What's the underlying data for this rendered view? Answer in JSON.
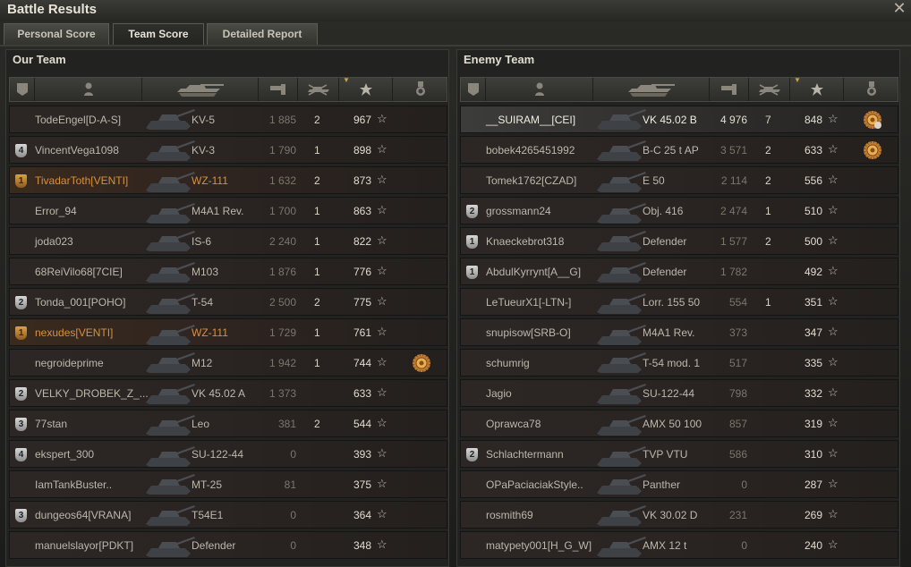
{
  "window": {
    "title": "Battle Results",
    "close_icon": "close-icon"
  },
  "tabs": [
    {
      "label": "Personal Score",
      "active": false
    },
    {
      "label": "Team Score",
      "active": true
    },
    {
      "label": "Detailed Report",
      "active": false
    }
  ],
  "header_icons": [
    "rank-icon",
    "player-icon",
    "tank-icon",
    "xp-icon",
    "kills-icon",
    "score-star-icon",
    "medal-icon"
  ],
  "our_team": {
    "title": "Our Team",
    "rows": [
      {
        "name": "TodeEngel[D-A-S]",
        "tank": "KV-5",
        "xp": "1 885",
        "kills": "2",
        "score": "967",
        "rank": "",
        "style": ""
      },
      {
        "name": "VincentVega1098",
        "tank": "KV-3",
        "xp": "1 790",
        "kills": "1",
        "score": "898",
        "rank": "4",
        "style": ""
      },
      {
        "name": "TivadarToth[VENTI]",
        "tank": "WZ-111",
        "xp": "1 632",
        "kills": "2",
        "score": "873",
        "rank": "1",
        "rank_style": "gold",
        "style": "orange"
      },
      {
        "name": "Error_94",
        "tank": "M4A1 Rev.",
        "xp": "1 700",
        "kills": "1",
        "score": "863",
        "rank": "",
        "style": ""
      },
      {
        "name": "joda023",
        "tank": "IS-6",
        "xp": "2 240",
        "kills": "1",
        "score": "822",
        "rank": "",
        "style": ""
      },
      {
        "name": "68ReiVilo68[7CIE]",
        "tank": "M103",
        "xp": "1 876",
        "kills": "1",
        "score": "776",
        "rank": "",
        "style": ""
      },
      {
        "name": "Tonda_001[POHO]",
        "tank": "T-54",
        "xp": "2 500",
        "kills": "2",
        "score": "775",
        "rank": "2",
        "style": ""
      },
      {
        "name": "nexudes[VENTI]",
        "tank": "WZ-111",
        "xp": "1 729",
        "kills": "1",
        "score": "761",
        "rank": "1",
        "rank_style": "gold",
        "style": "orange"
      },
      {
        "name": "negroideprime",
        "tank": "M12",
        "xp": "1 942",
        "kills": "1",
        "score": "744",
        "rank": "",
        "style": "",
        "medal": true
      },
      {
        "name": "VELKY_DROBEK_Z_...",
        "tank": "VK 45.02 A",
        "xp": "1 373",
        "kills": "",
        "score": "633",
        "rank": "2",
        "style": ""
      },
      {
        "name": "77stan",
        "tank": "Leo",
        "xp": "381",
        "kills": "2",
        "score": "544",
        "rank": "3",
        "style": ""
      },
      {
        "name": "ekspert_300",
        "tank": "SU-122-44",
        "xp": "0",
        "kills": "",
        "score": "393",
        "rank": "4",
        "style": ""
      },
      {
        "name": "IamTankBuster..",
        "tank": "MT-25",
        "xp": "81",
        "kills": "",
        "score": "375",
        "rank": "",
        "style": ""
      },
      {
        "name": "dungeos64[VRANA]",
        "tank": "T54E1",
        "xp": "0",
        "kills": "",
        "score": "364",
        "rank": "3",
        "style": ""
      },
      {
        "name": "manuelslayor[PDKT]",
        "tank": "Defender",
        "xp": "0",
        "kills": "",
        "score": "348",
        "rank": "",
        "style": ""
      }
    ]
  },
  "enemy_team": {
    "title": "Enemy Team",
    "rows": [
      {
        "name": "__SUIRAM__[CEI]",
        "tank": "VK 45.02 B",
        "xp": "4 976",
        "kills": "7",
        "score": "848",
        "rank": "",
        "style": "white",
        "medal": true,
        "medal_badge": "4"
      },
      {
        "name": "bobek4265451992",
        "tank": "B-C 25 t AP",
        "xp": "3 571",
        "kills": "2",
        "score": "633",
        "rank": "",
        "style": "",
        "medal": true
      },
      {
        "name": "Tomek1762[CZAD]",
        "tank": "E 50",
        "xp": "2 114",
        "kills": "2",
        "score": "556",
        "rank": "",
        "style": ""
      },
      {
        "name": "grossmann24",
        "tank": "Obj. 416",
        "xp": "2 474",
        "kills": "1",
        "score": "510",
        "rank": "2",
        "style": ""
      },
      {
        "name": "Knaeckebrot318",
        "tank": "Defender",
        "xp": "1 577",
        "kills": "2",
        "score": "500",
        "rank": "1",
        "style": ""
      },
      {
        "name": "AbdulKyrrynt[A__G]",
        "tank": "Defender",
        "xp": "1 782",
        "kills": "",
        "score": "492",
        "rank": "1",
        "style": ""
      },
      {
        "name": "LeTueurX1[-LTN-]",
        "tank": "Lorr. 155 50",
        "xp": "554",
        "kills": "1",
        "score": "351",
        "rank": "",
        "style": ""
      },
      {
        "name": "snupisow[SRB-O]",
        "tank": "M4A1 Rev.",
        "xp": "373",
        "kills": "",
        "score": "347",
        "rank": "",
        "style": ""
      },
      {
        "name": "schumrig",
        "tank": "T-54 mod. 1",
        "xp": "517",
        "kills": "",
        "score": "335",
        "rank": "",
        "style": ""
      },
      {
        "name": "Jagio",
        "tank": "SU-122-44",
        "xp": "798",
        "kills": "",
        "score": "332",
        "rank": "",
        "style": ""
      },
      {
        "name": "Oprawca78",
        "tank": "AMX 50 100",
        "xp": "857",
        "kills": "",
        "score": "319",
        "rank": "",
        "style": ""
      },
      {
        "name": "Schlachtermann",
        "tank": "TVP VTU",
        "xp": "586",
        "kills": "",
        "score": "310",
        "rank": "2",
        "style": ""
      },
      {
        "name": "OPaPaciaciakStyle..",
        "tank": "Panther",
        "xp": "0",
        "kills": "",
        "score": "287",
        "rank": "",
        "style": ""
      },
      {
        "name": "rosmith69",
        "tank": "VK 30.02 D",
        "xp": "231",
        "kills": "",
        "score": "269",
        "rank": "",
        "style": ""
      },
      {
        "name": "matypety001[H_G_W]",
        "tank": "AMX 12 t",
        "xp": "0",
        "kills": "",
        "score": "240",
        "rank": "",
        "style": ""
      }
    ]
  }
}
